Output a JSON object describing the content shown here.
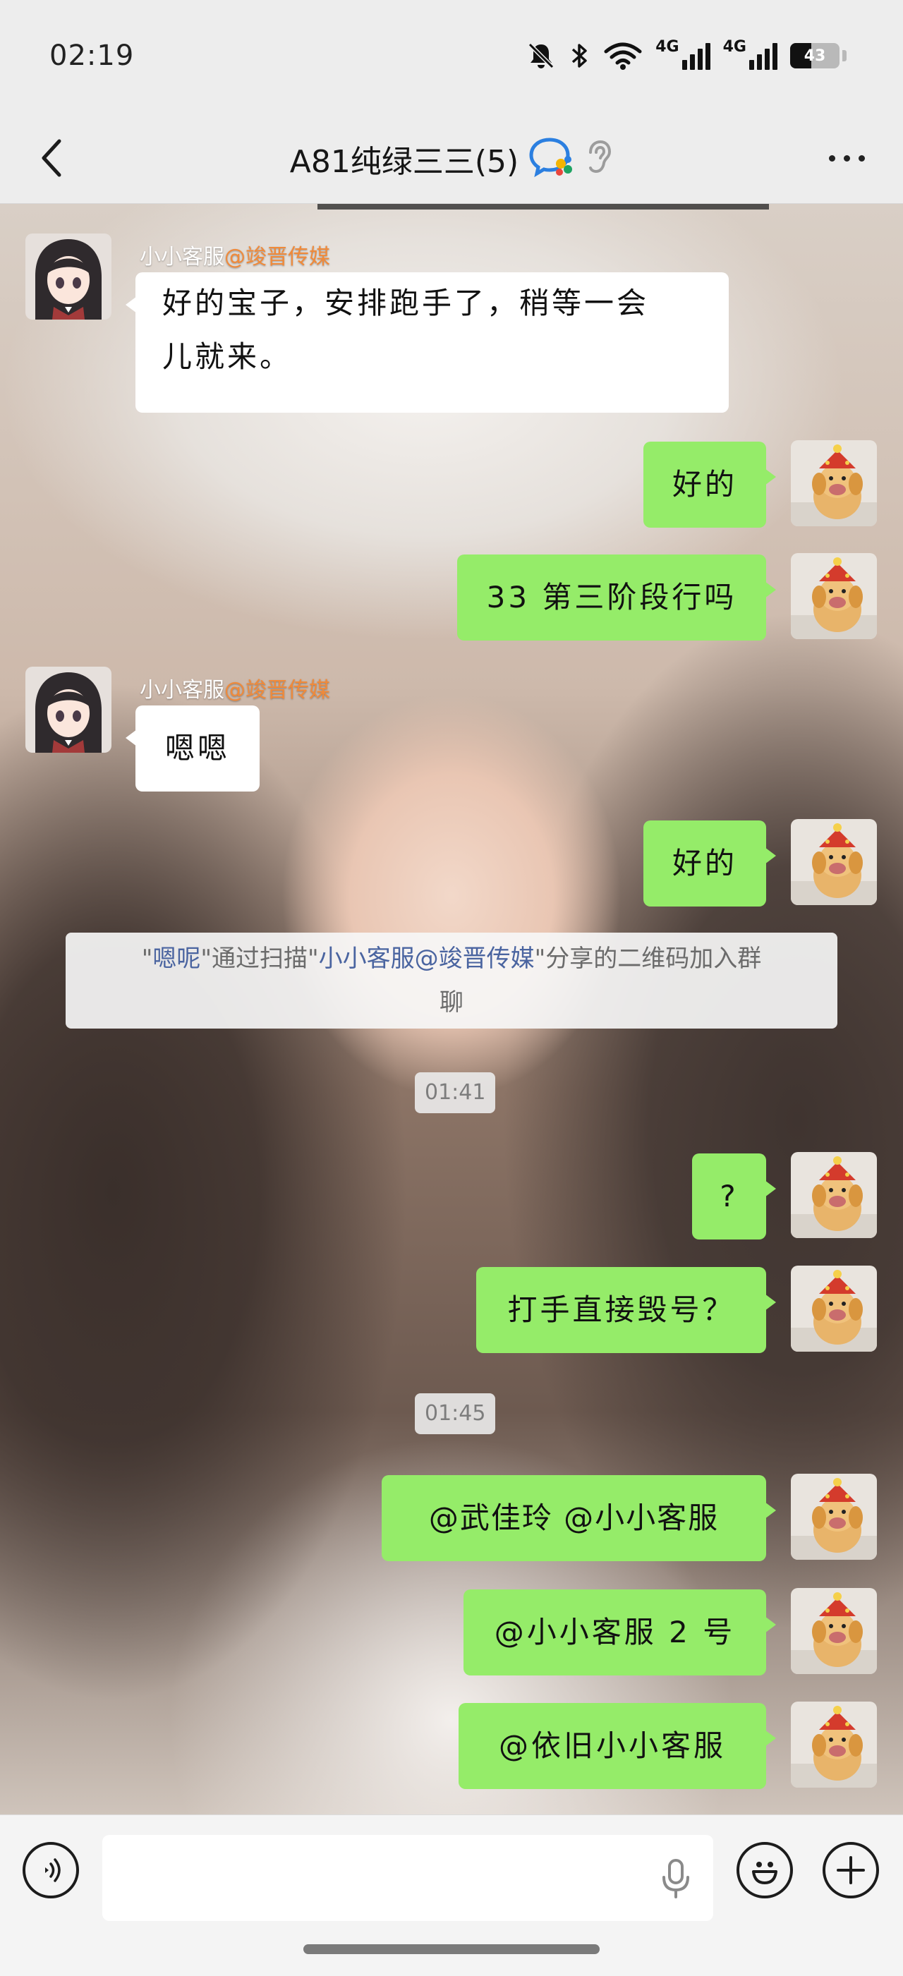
{
  "status_bar": {
    "time": "02:19",
    "network_1": "4G",
    "network_2": "4G",
    "battery": "43",
    "battery_level_percent": 43,
    "icons": [
      "mute-bell-icon",
      "bluetooth-icon",
      "wifi-icon",
      "signal-icon",
      "signal-icon",
      "battery-icon"
    ]
  },
  "header": {
    "title": "A81纯绿三三(5)",
    "icons": [
      "back-arrow-icon",
      "enterprise-group-icon",
      "earpiece-mode-icon",
      "more-dots-icon"
    ]
  },
  "messages": [
    {
      "side": "incoming",
      "sender": "小小客服",
      "sender_tag": "@竣晋传媒",
      "text_line1": "好的宝子，安排跑手了，稍等一会",
      "text_line2": "儿就来。"
    },
    {
      "side": "outgoing",
      "text": "好的"
    },
    {
      "side": "outgoing",
      "text": "33 第三阶段行吗"
    },
    {
      "side": "incoming",
      "sender": "小小客服",
      "sender_tag": "@竣晋传媒",
      "text": "嗯嗯"
    },
    {
      "side": "outgoing",
      "text": "好的"
    },
    {
      "side": "system",
      "q1": "\"",
      "name": "嗯呢",
      "q2": "\"通过扫描\"",
      "inviter": "小小客服@竣晋传媒",
      "q3": "\"",
      "rest_line1": "分享的二维码加入群",
      "rest_line2": "聊"
    },
    {
      "side": "time",
      "text": "01:41"
    },
    {
      "side": "outgoing",
      "text": "?"
    },
    {
      "side": "outgoing",
      "text": "打手直接毁号？"
    },
    {
      "side": "time",
      "text": "01:45"
    },
    {
      "side": "outgoing",
      "text": "@武佳玲 @小小客服"
    },
    {
      "side": "outgoing",
      "text": "@小小客服 2 号"
    },
    {
      "side": "outgoing",
      "text": "@依旧小小客服"
    }
  ],
  "input_bar": {
    "placeholder": "",
    "icons": [
      "voice-mode-icon",
      "microphone-icon",
      "emoji-icon",
      "add-plus-icon"
    ]
  },
  "colors": {
    "outgoing_bubble": "#95ec69",
    "incoming_bubble": "#ffffff",
    "sender_tag": "#f08a3a",
    "system_link": "#4a64a0",
    "bar_background": "#ededed"
  }
}
